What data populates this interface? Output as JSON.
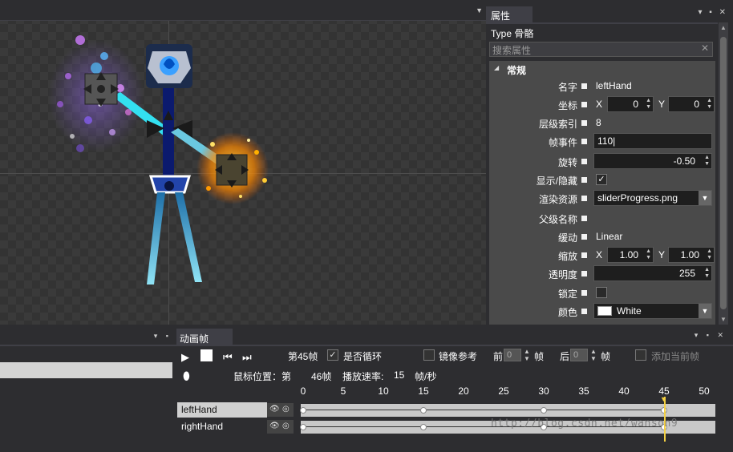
{
  "properties_panel": {
    "tab_label": "属性",
    "type_label": "Type 骨骼",
    "search_placeholder": "搜索属性",
    "group_label": "常规",
    "rows": {
      "name": {
        "label": "名字",
        "value": "leftHand"
      },
      "position": {
        "label": "坐标",
        "x_label": "X",
        "x_value": "0",
        "y_label": "Y",
        "y_value": "0"
      },
      "layer_index": {
        "label": "层级索引",
        "value": "8"
      },
      "frame_event": {
        "label": "帧事件",
        "value": "110"
      },
      "rotation": {
        "label": "旋转",
        "value": "-0.50"
      },
      "visibility": {
        "label": "显示/隐藏",
        "checked_mark": "✓"
      },
      "render_resource": {
        "label": "渲染资源",
        "value": "sliderProgress.png"
      },
      "parent_name": {
        "label": "父级名称",
        "value": ""
      },
      "easing": {
        "label": "缓动",
        "value": "Linear"
      },
      "scale": {
        "label": "缩放",
        "x_label": "X",
        "x_value": "1.00",
        "y_label": "Y",
        "y_value": "1.00"
      },
      "opacity": {
        "label": "透明度",
        "value": "255"
      },
      "lock": {
        "label": "锁定"
      },
      "color": {
        "label": "颜色",
        "value": "White",
        "swatch": "#ffffff"
      }
    }
  },
  "animation_panel": {
    "tab_label": "动画帧",
    "current_frame": "第45帧",
    "loop_label": "是否循环",
    "mirror_label": "镜像参考",
    "before_label": "前",
    "before_value": "0",
    "before_unit": "帧",
    "after_label": "后",
    "after_value": "0",
    "after_unit": "帧",
    "add_current_label": "添加当前帧",
    "mouse_pos_label": "鼠标位置：第",
    "mouse_pos_value": "46帧",
    "play_rate_label": "播放速率:",
    "play_rate_value": "15",
    "play_rate_unit": "帧/秒",
    "ruler_ticks": [
      "0",
      "5",
      "10",
      "15",
      "20",
      "25",
      "30",
      "35",
      "40",
      "45",
      "50"
    ],
    "tracks": [
      {
        "name": "leftHand",
        "keyframes": [
          0,
          15,
          30,
          45
        ]
      },
      {
        "name": "rightHand",
        "keyframes": [
          0,
          15,
          30,
          45
        ]
      }
    ],
    "playhead_frame": 45
  },
  "watermark": "http://blog.csdn.net/wanson9"
}
